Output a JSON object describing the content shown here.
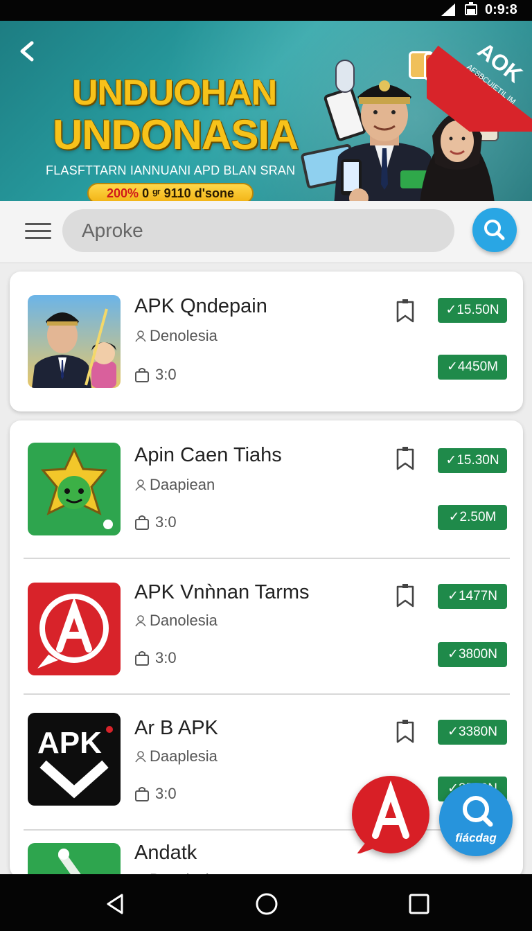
{
  "status_bar": {
    "time": "0:9:8"
  },
  "banner": {
    "title_line1": "UNDUOHAN",
    "title_line2": "UNDONASIA",
    "subtitle": "FLASFTTARN IANNUANI APD BLAN SRAN",
    "pill_red": "200%",
    "pill_rest": " 0 ᵍʳ 9110 d'sone",
    "ribbon_big": "AOK",
    "ribbon_small": "AFSBCUIETIL IM"
  },
  "search": {
    "placeholder": "Aproke"
  },
  "apps": [
    {
      "name": "APK Qndepain",
      "developer": "Denolesia",
      "version": "3:0",
      "badge_top": "✓15.50N",
      "badge_bottom": "✓4450M"
    },
    {
      "name": "Apin Caen Tiahs",
      "developer": "Daapiean",
      "version": "3:0",
      "badge_top": "✓15.30N",
      "badge_bottom": "✓2.50M"
    },
    {
      "name": "APK Vnǹnan Tarms",
      "developer": "Danolesia",
      "version": "3:0",
      "badge_top": "✓1477N",
      "badge_bottom": "✓3800N"
    },
    {
      "name": "Ar B APK",
      "developer": "Daaplesia",
      "version": "3:0",
      "badge_top": "✓3380N",
      "badge_bottom": "✓3529N"
    },
    {
      "name": "Andatk",
      "developer": "Daaplesia"
    }
  ],
  "icon_text": {
    "apk_logo": "APK"
  },
  "fab": {
    "blue_label": "fiácdag"
  },
  "colors": {
    "accent_green": "#1f8a4a",
    "accent_blue": "#29a6e4",
    "fab_red": "#d81f26",
    "banner_teal": "#1d7d82"
  },
  "icons": [
    "back-arrow-icon",
    "menu-icon",
    "search-icon",
    "bookmark-icon",
    "developer-icon",
    "bag-icon",
    "nav-back-icon",
    "nav-home-icon",
    "nav-recents-icon"
  ]
}
